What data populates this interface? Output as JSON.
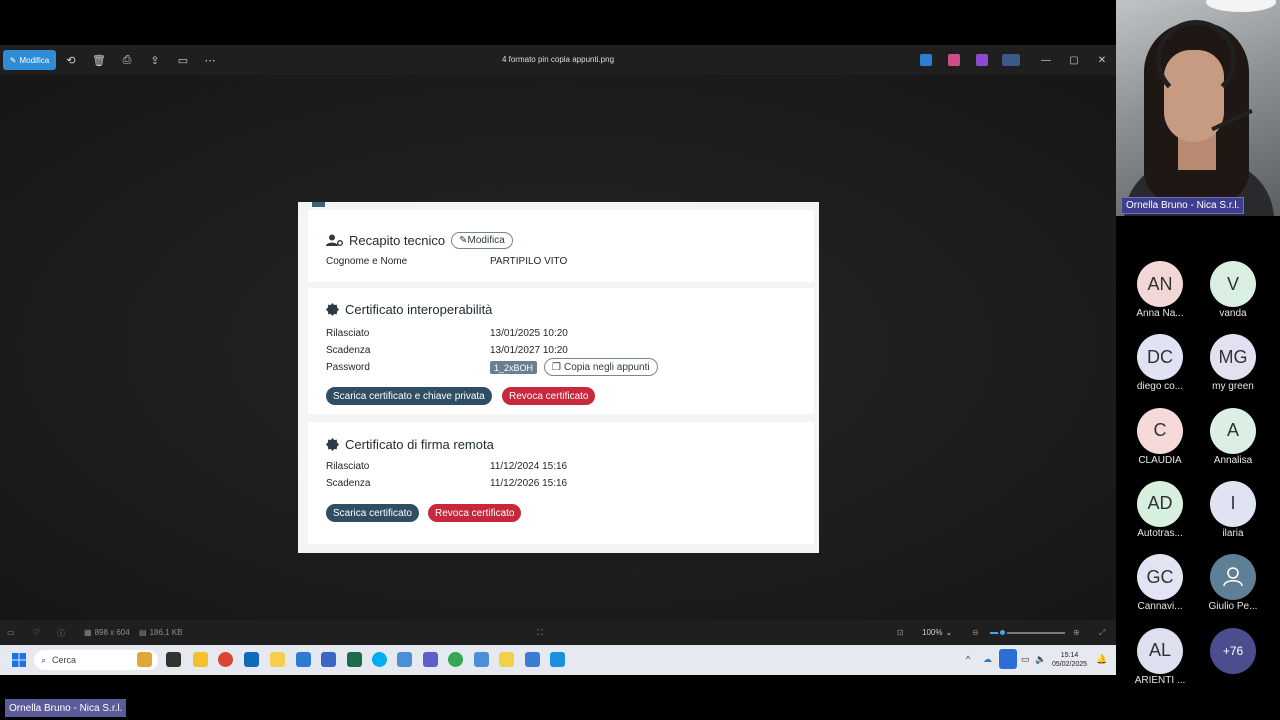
{
  "viewer": {
    "edit_label": "Modifica",
    "file_title": "4 formato pin copia appunti.png",
    "status": {
      "dimensions": "898 x 604",
      "filesize": "186,1 KB",
      "zoom": "100%"
    }
  },
  "doc": {
    "recapito": {
      "title": "Recapito tecnico",
      "edit_label": "Modifica",
      "name_label": "Cognome e Nome",
      "name_value": "PARTIPILO VITO"
    },
    "interop": {
      "title": "Certificato interoperabilità",
      "issued_label": "Rilasciato",
      "issued_value": "13/01/2025 10:20",
      "expiry_label": "Scadenza",
      "expiry_value": "13/01/2027 10:20",
      "password_label": "Password",
      "password_value": "1_2xBOH",
      "copy_label": "Copia negli appunti",
      "download_label": "Scarica certificato e chiave privata",
      "revoke_label": "Revoca certificato"
    },
    "remote": {
      "title": "Certificato di firma remota",
      "issued_label": "Rilasciato",
      "issued_value": "11/12/2024 15:16",
      "expiry_label": "Scadenza",
      "expiry_value": "11/12/2026 15:16",
      "download_label": "Scarica certificato",
      "revoke_label": "Revoca certificato"
    }
  },
  "taskbar": {
    "search_placeholder": "Cerca",
    "time": "15:14",
    "date": "05/02/2025"
  },
  "meeting": {
    "speaker_name": "Ornella Bruno - Nica S.r.l.",
    "participants": [
      {
        "initials": "AN",
        "name": "Anna Na...",
        "color": "#f3d6d6"
      },
      {
        "initials": "V",
        "name": "vanda",
        "color": "#d8efe2"
      },
      {
        "initials": "DC",
        "name": "diego co...",
        "color": "#dfe3f3"
      },
      {
        "initials": "MG",
        "name": "my green",
        "color": "#e4e0f1"
      },
      {
        "initials": "C",
        "name": "CLAUDIA",
        "color": "#f6d9d9"
      },
      {
        "initials": "A",
        "name": "Annalisa",
        "color": "#dcefe5"
      },
      {
        "initials": "AD",
        "name": "Autotras...",
        "color": "#d6efdf"
      },
      {
        "initials": "I",
        "name": "ilaria",
        "color": "#e0e3f2"
      },
      {
        "initials": "GC",
        "name": "Cannavi...",
        "color": "#e2e4f4"
      },
      {
        "initials": "",
        "name": "Giulio Pe...",
        "color": "#5e7f95"
      },
      {
        "initials": "AL",
        "name": "ARIENTI ...",
        "color": "#dde0ee"
      },
      {
        "initials": "+76",
        "name": "",
        "color": "#4b4d8e"
      }
    ]
  }
}
